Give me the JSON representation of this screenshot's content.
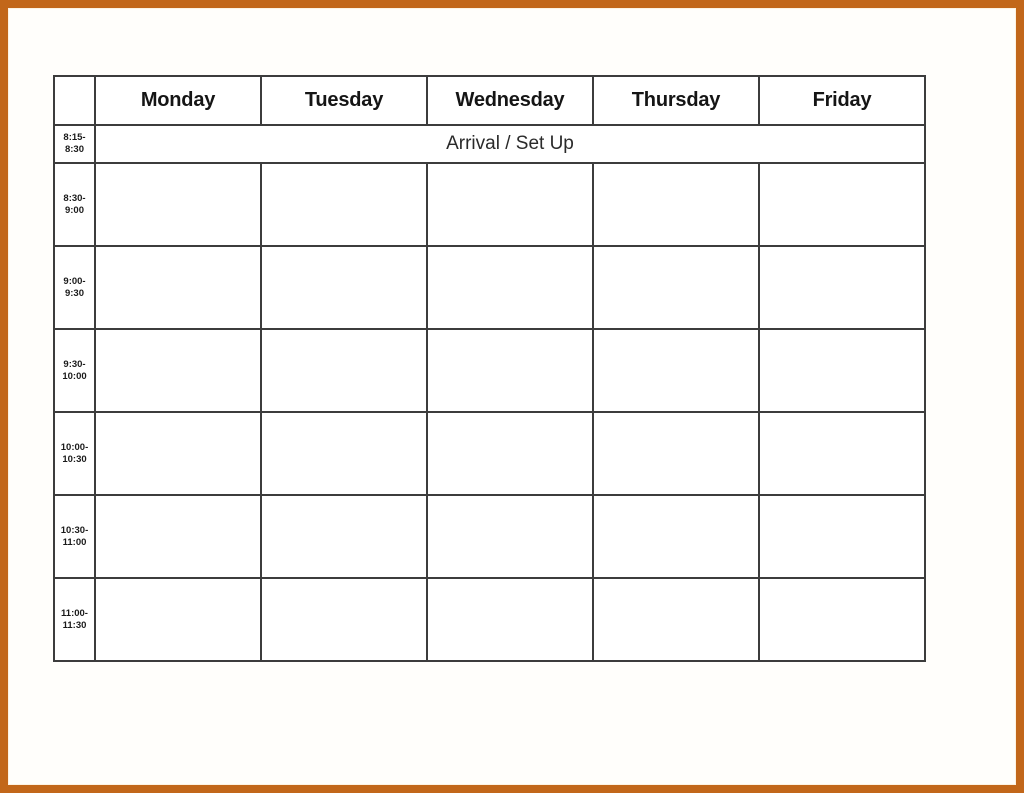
{
  "page": {
    "background_color": "#ffffff",
    "frame_color": "#c2671a",
    "grid_color": "#3c3c3c"
  },
  "schedule": {
    "corner_label": "",
    "day_headers": [
      "Monday",
      "Tuesday",
      "Wednesday",
      "Thursday",
      "Friday"
    ],
    "arrival_row": {
      "time_start": "8:15-",
      "time_end": "8:30",
      "label": "Arrival / Set Up"
    },
    "rows": [
      {
        "time_start": "8:30-",
        "time_end": "9:00",
        "cells": [
          "",
          "",
          "",
          "",
          ""
        ]
      },
      {
        "time_start": "9:00-",
        "time_end": "9:30",
        "cells": [
          "",
          "",
          "",
          "",
          ""
        ]
      },
      {
        "time_start": "9:30-",
        "time_end": "10:00",
        "cells": [
          "",
          "",
          "",
          "",
          ""
        ]
      },
      {
        "time_start": "10:00-",
        "time_end": "10:30",
        "cells": [
          "",
          "",
          "",
          "",
          ""
        ]
      },
      {
        "time_start": "10:30-",
        "time_end": "11:00",
        "cells": [
          "",
          "",
          "",
          "",
          ""
        ]
      },
      {
        "time_start": "11:00-",
        "time_end": "11:30",
        "cells": [
          "",
          "",
          "",
          "",
          ""
        ]
      }
    ]
  }
}
